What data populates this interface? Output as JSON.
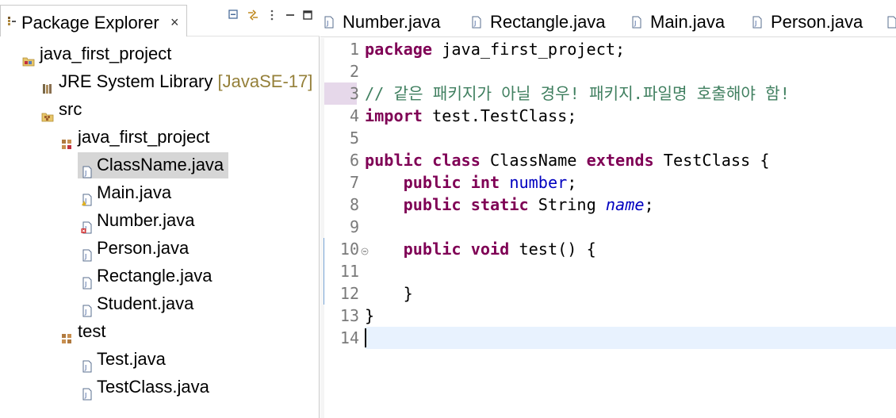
{
  "explorer": {
    "tab_label": "Package Explorer",
    "close_glyph": "×",
    "toolbar": [
      {
        "name": "collapse-all-icon"
      },
      {
        "name": "link-with-editor-icon"
      },
      {
        "name": "view-menu-icon"
      },
      {
        "name": "minimize-icon"
      },
      {
        "name": "maximize-icon"
      }
    ],
    "tree": [
      {
        "label": "java_first_project",
        "icon": "project-icon"
      },
      {
        "label": "JRE System Library",
        "decoration": "[JavaSE-17]",
        "icon": "library-icon"
      },
      {
        "label": "src",
        "icon": "source-folder-icon"
      },
      {
        "label": "java_first_project",
        "icon": "package-icon"
      },
      {
        "label": "ClassName.java",
        "icon": "java-file-icon",
        "selected": true
      },
      {
        "label": "Main.java",
        "icon": "java-file-warning-icon"
      },
      {
        "label": "Number.java",
        "icon": "java-file-error-icon"
      },
      {
        "label": "Person.java",
        "icon": "java-file-icon"
      },
      {
        "label": "Rectangle.java",
        "icon": "java-file-icon"
      },
      {
        "label": "Student.java",
        "icon": "java-file-icon"
      },
      {
        "label": "test",
        "icon": "package-icon"
      },
      {
        "label": "Test.java",
        "icon": "java-file-icon"
      },
      {
        "label": "TestClass.java",
        "icon": "java-file-icon"
      }
    ]
  },
  "editor": {
    "tabs": [
      {
        "label": "Number.java"
      },
      {
        "label": "Rectangle.java"
      },
      {
        "label": "Main.java"
      },
      {
        "label": "Person.java"
      }
    ],
    "line_numbers": [
      "1",
      "2",
      "3",
      "4",
      "5",
      "6",
      "7",
      "8",
      "9",
      "10",
      "11",
      "12",
      "13",
      "14"
    ],
    "code": {
      "l1_kw": "package",
      "l1_rest": " java_first_project;",
      "l3_comment": "// 같은 패키지가 아닐 경우! 패키지.파일명 호출해야 함!",
      "l4_kw": "import",
      "l4_rest": " test.TestClass;",
      "l6_kw1": "public",
      "l6_kw2": "class",
      "l6_name": " ClassName ",
      "l6_kw3": "extends",
      "l6_rest": " TestClass {",
      "l7_kw1": "public",
      "l7_kw2": "int",
      "l7_field": "number",
      "l7_end": ";",
      "l8_kw1": "public",
      "l8_kw2": "static",
      "l8_type": " String ",
      "l8_field": "name",
      "l8_end": ";",
      "l10_kw1": "public",
      "l10_kw2": "void",
      "l10_rest": " test() {",
      "l12_brace": "}",
      "l13_brace": "}"
    },
    "colors": {
      "keyword": "#7f0055",
      "comment": "#3f7f5f",
      "field": "#0000c0",
      "current_line": "#e8f2fe"
    }
  }
}
